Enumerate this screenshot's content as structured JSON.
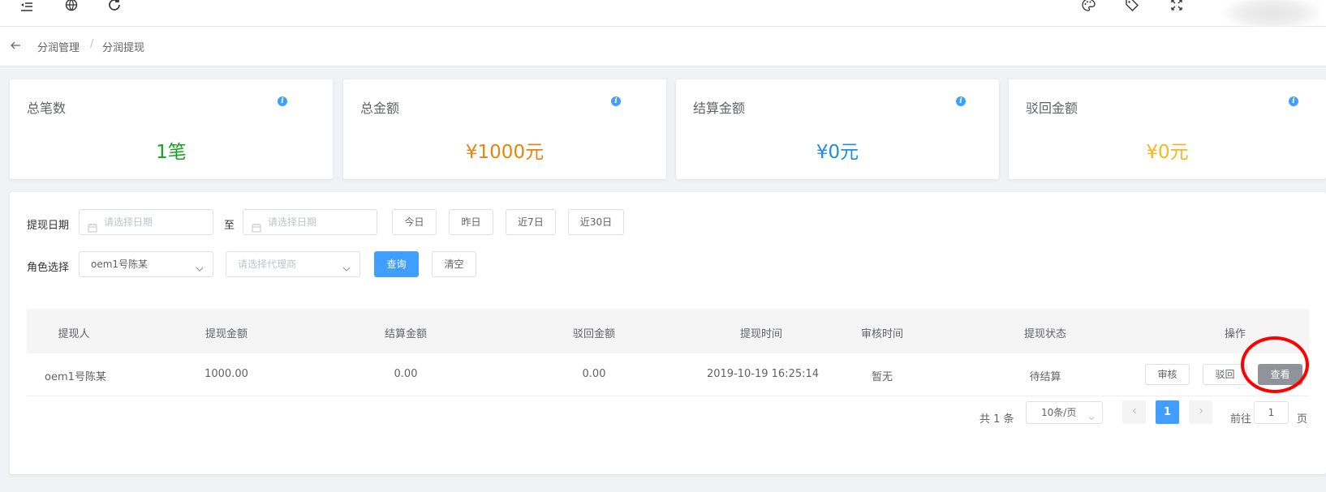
{
  "breadcrumb": {
    "level1": "分润管理",
    "sep": "/",
    "level2": "分润提现"
  },
  "stats": [
    {
      "title": "总笔数",
      "value": "1笔",
      "color": "#19a025"
    },
    {
      "title": "总金额",
      "value": "¥1000元",
      "color": "#e6850e"
    },
    {
      "title": "结算金额",
      "value": "¥0元",
      "color": "#1e8fe0"
    },
    {
      "title": "驳回金额",
      "value": "¥0元",
      "color": "#f3b81a"
    }
  ],
  "filters": {
    "date_label": "提现日期",
    "start_placeholder": "请选择日期",
    "to": "至",
    "end_placeholder": "请选择日期",
    "quick": [
      "今日",
      "昨日",
      "近7日",
      "近30日"
    ],
    "role_label": "角色选择",
    "role_value": "oem1号陈某",
    "agent_placeholder": "请选择代理商",
    "query": "查询",
    "clear": "清空"
  },
  "table": {
    "headers": [
      "提现人",
      "提现金额",
      "结算金额",
      "驳回金额",
      "提现时间",
      "审核时间",
      "提现状态",
      "操作"
    ],
    "rows": [
      {
        "cells": [
          "oem1号陈某",
          "1000.00",
          "0.00",
          "0.00",
          "2019-10-19 16:25:14",
          "暂无",
          "待结算"
        ],
        "actions": [
          "审核",
          "驳回",
          "查看"
        ]
      }
    ]
  },
  "pagination": {
    "total": "共 1 条",
    "page_size": "10条/页",
    "current": "1",
    "goto_prefix": "前往",
    "goto_value": "1",
    "goto_suffix": "页"
  }
}
